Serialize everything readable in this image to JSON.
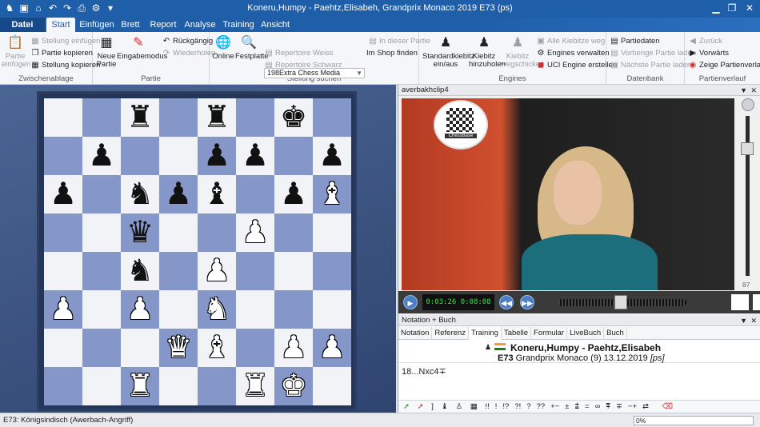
{
  "titlebar": {
    "title": "Koneru,Humpy - Paehtz,Elisabeh, Grandprix Monaco 2019  E73  (ps)"
  },
  "ribbon_tabs": [
    "Datei",
    "Start",
    "Einfügen",
    "Brett",
    "Report",
    "Analyse",
    "Training",
    "Ansicht"
  ],
  "ribbon": {
    "clipboard": {
      "label": "Zwischenablage",
      "paste": "Partie einfügen",
      "paste_pos": "Stellung einfügen",
      "copy_game": "Partie kopieren",
      "copy_pos": "Stellung kopieren"
    },
    "game": {
      "label": "Partie",
      "new_game": "Neue Partie",
      "input_mode": "Eingabemodus",
      "undo": "Rückgängig",
      "redo": "Wiederholen"
    },
    "search": {
      "label": "Stellung suchen",
      "online": "Online",
      "hard_disk": "Festplatte",
      "database": "198Extra Chess Media",
      "rep_white": "Repertoire Weiss",
      "rep_black": "Repertoire Schwarz",
      "in_game": "In dieser Partie",
      "in_shop": "Im Shop finden"
    },
    "engines": {
      "label": "Engines",
      "standard_kibitz": "Standardkiebitz ein/aus",
      "add_kibitz": "Kiebitz hinzuholen",
      "remove_kibitz": "Kiebitz wegschicken",
      "all_kibitz_away": "Alle Kiebitze weg",
      "manage_engines": "Engines verwalten",
      "create_uci": "UCI Engine erstellen"
    },
    "database": {
      "label": "Datenbank",
      "game_data": "Partiedaten",
      "prev_game": "Vorherige Partie laden",
      "next_game": "Nächste Partie laden"
    },
    "history": {
      "label": "Partienverlauf",
      "back": "Zurück",
      "forward": "Vorwärts",
      "show_history": "Zeige Partienverlauf"
    }
  },
  "board": {
    "ranks": [
      [
        "",
        "",
        "r",
        "",
        "r",
        "",
        "k",
        ""
      ],
      [
        "",
        "p",
        "",
        "",
        "p",
        "p",
        "",
        "p"
      ],
      [
        "p",
        "",
        "n",
        "p",
        "b",
        "",
        "p",
        "B"
      ],
      [
        "",
        "",
        "q",
        "",
        "",
        "P",
        "",
        ""
      ],
      [
        "",
        "",
        "n",
        "",
        "P",
        "",
        "",
        ""
      ],
      [
        "P",
        "",
        "P",
        "",
        "N",
        "",
        "",
        ""
      ],
      [
        "",
        "",
        "",
        "Q",
        "B",
        "",
        "P",
        "P"
      ],
      [
        "",
        "",
        "R",
        "",
        "",
        "R",
        "K",
        ""
      ]
    ]
  },
  "video": {
    "title": "averbakhclip4",
    "logo_text": "ChessBase",
    "timecode": "0:03:26 0:08:08",
    "volume": "87"
  },
  "notation": {
    "title": "Notation + Buch",
    "tabs": [
      "Notation",
      "Referenz",
      "Training",
      "Tabelle",
      "Formular",
      "LiveBuch",
      "Buch"
    ],
    "players": "Koneru,Humpy - Paehtz,Elisabeh",
    "eco": "E73",
    "event": "Grandprix Monaco (9) 13.12.2019",
    "source": "[ps]",
    "move": "18...Nxc4∓",
    "symbols": [
      "!!",
      "!",
      "!?",
      "?!",
      "?",
      "??",
      "+−",
      "±",
      "⩲",
      "=",
      "∞",
      "⩱",
      "∓",
      "−+",
      "⇄"
    ]
  },
  "status": {
    "left": "E73: Königsindisch (Awerbach-Angriff)",
    "progress": "0%"
  }
}
